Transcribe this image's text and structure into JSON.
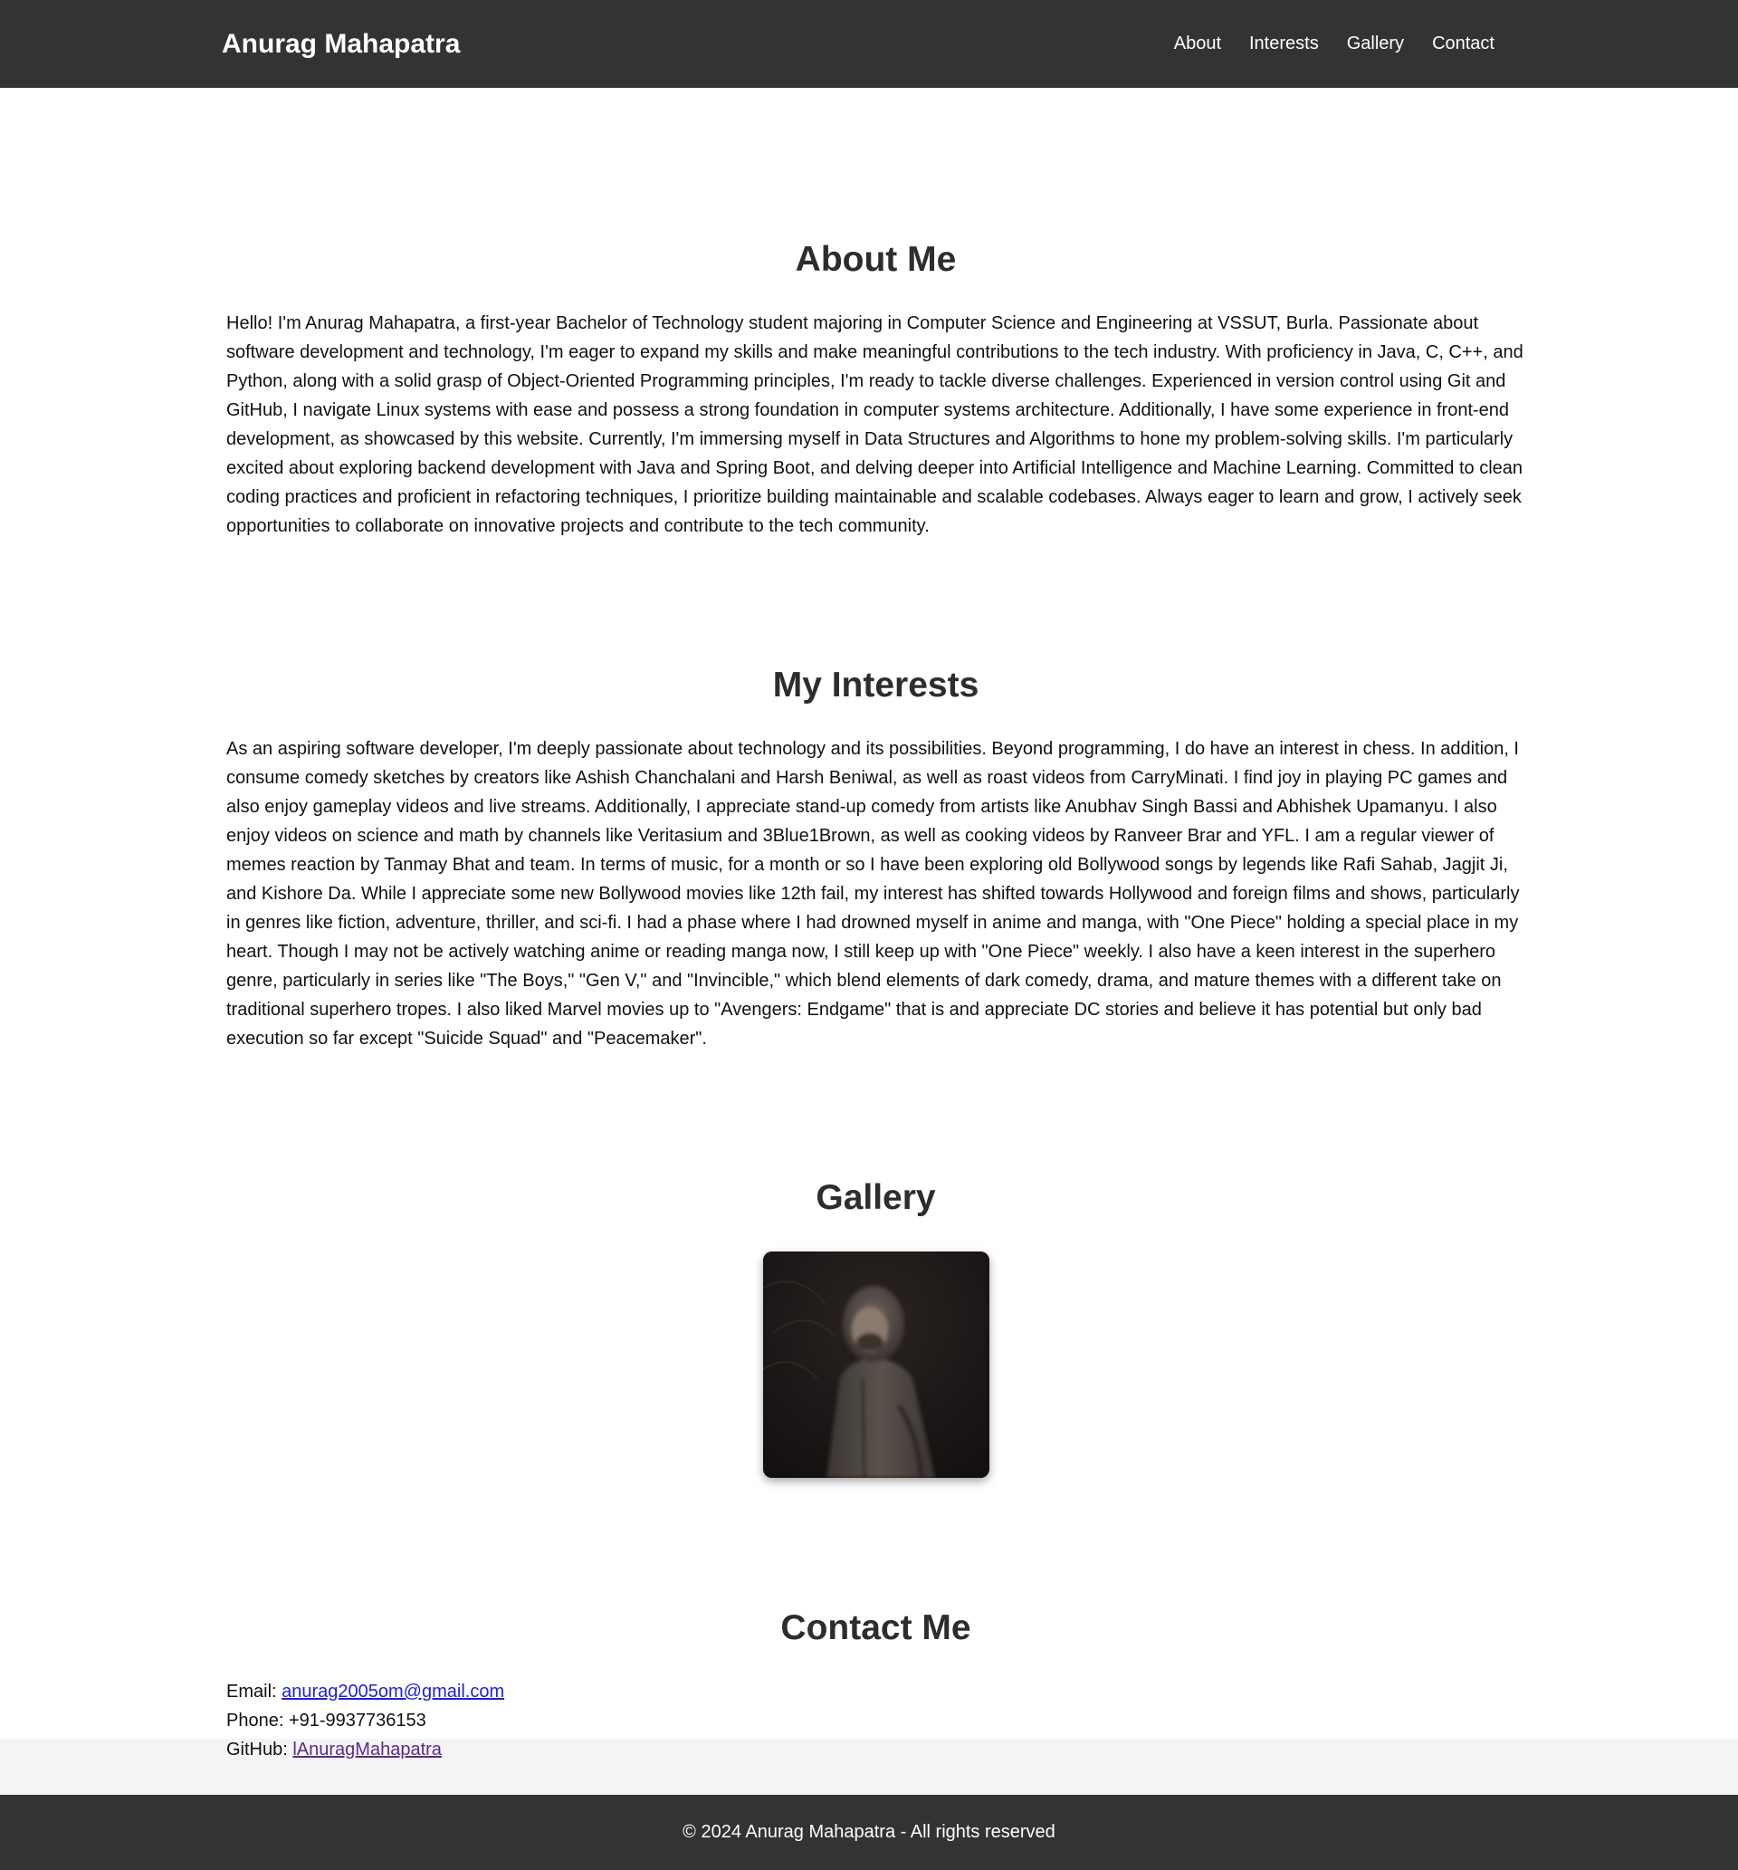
{
  "header": {
    "site_title": "Anurag Mahapatra",
    "nav": [
      "About",
      "Interests",
      "Gallery",
      "Contact"
    ]
  },
  "about": {
    "title": "About Me",
    "text": "Hello! I'm Anurag Mahapatra, a first-year Bachelor of Technology student majoring in Computer Science and Engineering at VSSUT, Burla. Passionate about software development and technology, I'm eager to expand my skills and make meaningful contributions to the tech industry. With proficiency in Java, C, C++, and Python, along with a solid grasp of Object-Oriented Programming principles, I'm ready to tackle diverse challenges. Experienced in version control using Git and GitHub, I navigate Linux systems with ease and possess a strong foundation in computer systems architecture. Additionally, I have some experience in front-end development, as showcased by this website. Currently, I'm immersing myself in Data Structures and Algorithms to hone my problem-solving skills. I'm particularly excited about exploring backend development with Java and Spring Boot, and delving deeper into Artificial Intelligence and Machine Learning. Committed to clean coding practices and proficient in refactoring techniques, I prioritize building maintainable and scalable codebases. Always eager to learn and grow, I actively seek opportunities to collaborate on innovative projects and contribute to the tech community."
  },
  "interests": {
    "title": "My Interests",
    "text": "As an aspiring software developer, I'm deeply passionate about technology and its possibilities. Beyond programming, I do have an interest in chess. In addition, I consume comedy sketches by creators like Ashish Chanchalani and Harsh Beniwal, as well as roast videos from CarryMinati. I find joy in playing PC games and also enjoy gameplay videos and live streams. Additionally, I appreciate stand-up comedy from artists like Anubhav Singh Bassi and Abhishek Upamanyu. I also enjoy videos on science and math by channels like Veritasium and 3Blue1Brown, as well as cooking videos by Ranveer Brar and YFL. I am a regular viewer of memes reaction by Tanmay Bhat and team. In terms of music, for a month or so I have been exploring old Bollywood songs by legends like Rafi Sahab, Jagjit Ji, and Kishore Da. While I appreciate some new Bollywood movies like 12th fail, my interest has shifted towards Hollywood and foreign films and shows, particularly in genres like fiction, adventure, thriller, and sci-fi. I had a phase where I had drowned myself in anime and manga, with \"One Piece\" holding a special place in my heart. Though I may not be actively watching anime or reading manga now, I still keep up with \"One Piece\" weekly. I also have a keen interest in the superhero genre, particularly in series like \"The Boys,\" \"Gen V,\" and \"Invincible,\" which blend elements of dark comedy, drama, and mature themes with a different take on traditional superhero tropes. I also liked Marvel movies up to \"Avengers: Endgame\" that is and appreciate DC stories and believe it has potential but only bad execution so far except \"Suicide Squad\" and \"Peacemaker\"."
  },
  "gallery": {
    "title": "Gallery"
  },
  "contact": {
    "title": "Contact Me",
    "email_label": "Email: ",
    "email": "anurag2005om@gmail.com",
    "phone_label": "Phone: ",
    "phone": "+91-9937736153",
    "github_label": "GitHub: ",
    "github": "lAnuragMahapatra"
  },
  "footer": {
    "text": "© 2024 Anurag Mahapatra - All rights reserved"
  },
  "colors": {
    "header_bg": "#333333",
    "page_bg": "#f4f4f4",
    "content_bg": "#ffffff",
    "email_link": "#1f1fd6",
    "github_link": "#5b2b87"
  }
}
